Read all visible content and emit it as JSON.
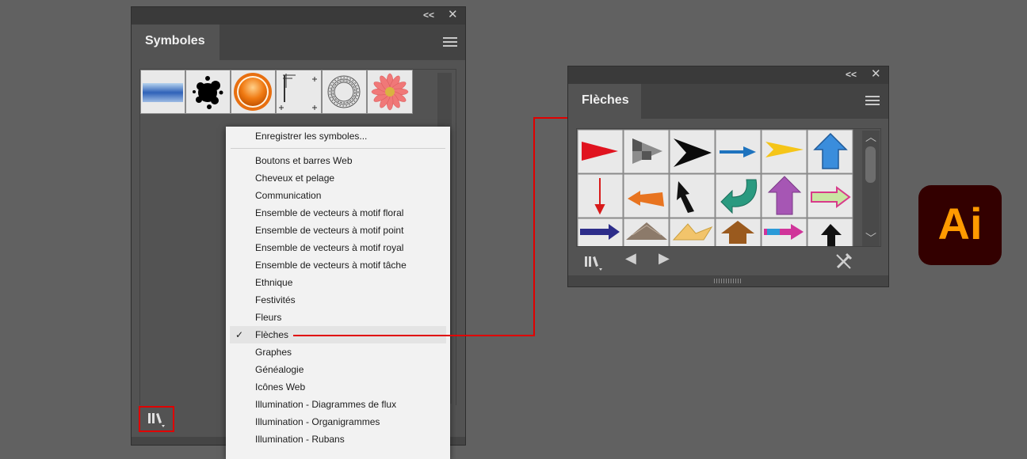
{
  "symbols_panel": {
    "tab_label": "Symboles",
    "collapse_glyph": "<<",
    "close_glyph": "✕",
    "menu_icon": "hamburger-icon",
    "thumbnails": [
      "button-bar",
      "ink-splatter",
      "orange-button",
      "registration-marks",
      "torus-ring",
      "daisy-flower"
    ],
    "library_icon": "symbol-library-icon"
  },
  "library_menu": {
    "save_item": "Enregistrer les symboles...",
    "items": [
      "Boutons et barres Web",
      "Cheveux et pelage",
      "Communication",
      "Ensemble de vecteurs à motif floral",
      "Ensemble de vecteurs à motif point",
      "Ensemble de vecteurs à motif royal",
      "Ensemble de vecteurs à motif tâche",
      "Ethnique",
      "Festivités",
      "Fleurs",
      "Flèches",
      "Graphes",
      "Généalogie",
      "Icônes Web",
      "Illumination - Diagrammes de flux",
      "Illumination - Organigrammes",
      "Illumination - Rubans"
    ],
    "checked_item": "Flèches",
    "check_glyph": "✓"
  },
  "arrows_panel": {
    "tab_label": "Flèches",
    "collapse_glyph": "<<",
    "close_glyph": "✕",
    "menu_icon": "hamburger-icon",
    "prev_glyph": "◀",
    "next_glyph": "▶",
    "scroll_up_glyph": "︿",
    "scroll_down_glyph": "﹀",
    "library_icon": "symbol-library-icon",
    "edit_icon": "break-link-icon"
  },
  "ai_logo": {
    "text": "Ai",
    "bg_color": "#330000",
    "text_color": "#ff9a00"
  },
  "highlight_color": "#e00000"
}
